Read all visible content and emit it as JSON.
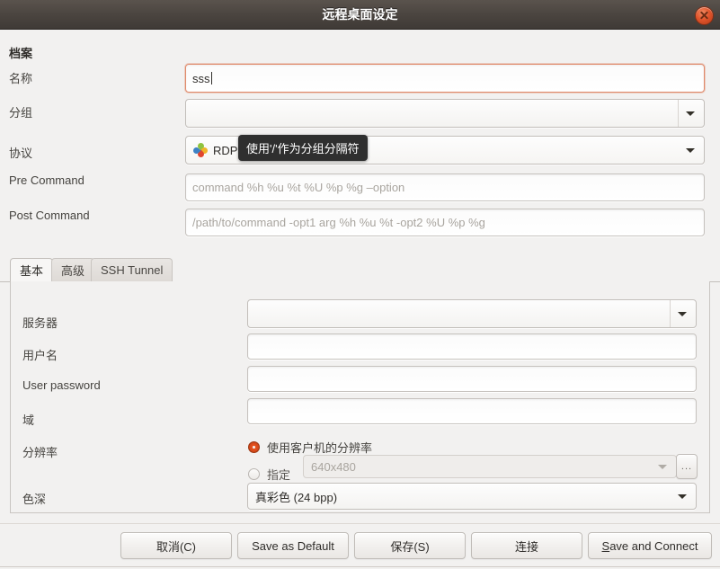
{
  "window": {
    "title": "远程桌面设定",
    "close_icon": "close-icon"
  },
  "profile": {
    "heading": "档案",
    "name": {
      "label": "名称",
      "value": "sss"
    },
    "group": {
      "label": "分组",
      "value": ""
    },
    "protocol": {
      "label": "协议",
      "value": "RDP",
      "icon": "rdp-protocol-icon"
    },
    "pre_command": {
      "label": "Pre Command",
      "placeholder": "command %h %u %t %U %p %g –option",
      "value": ""
    },
    "post_command": {
      "label": "Post Command",
      "placeholder": "/path/to/command -opt1 arg %h %u %t -opt2 %U %p %g",
      "value": ""
    }
  },
  "tooltip": {
    "text": "使用'/'作为分组分隔符"
  },
  "tabs": [
    {
      "label": "基本",
      "active": true
    },
    {
      "label": "高级",
      "active": false
    },
    {
      "label": "SSH Tunnel",
      "active": false
    }
  ],
  "basic": {
    "server": {
      "label": "服务器",
      "value": ""
    },
    "username": {
      "label": "用户名",
      "value": ""
    },
    "user_password": {
      "label": "User password",
      "value": ""
    },
    "domain": {
      "label": "域",
      "value": ""
    },
    "resolution": {
      "label": "分辨率",
      "option_client": "使用客户机的分辨率",
      "option_custom": "指定",
      "custom_value": "640x480",
      "browse_label": "..."
    },
    "color_depth": {
      "label": "色深",
      "value": "真彩色 (24 bpp)"
    }
  },
  "buttons": {
    "cancel": "取消(C)",
    "save_as_default": "Save as Default",
    "save": "保存(S)",
    "connect": "连接",
    "save_and_connect_prefix": "S",
    "save_and_connect_rest": "ave and Connect"
  },
  "colors": {
    "accent": "#e8541f",
    "titlebar": "#4b4540",
    "tooltip_bg": "#2f2f2f"
  }
}
